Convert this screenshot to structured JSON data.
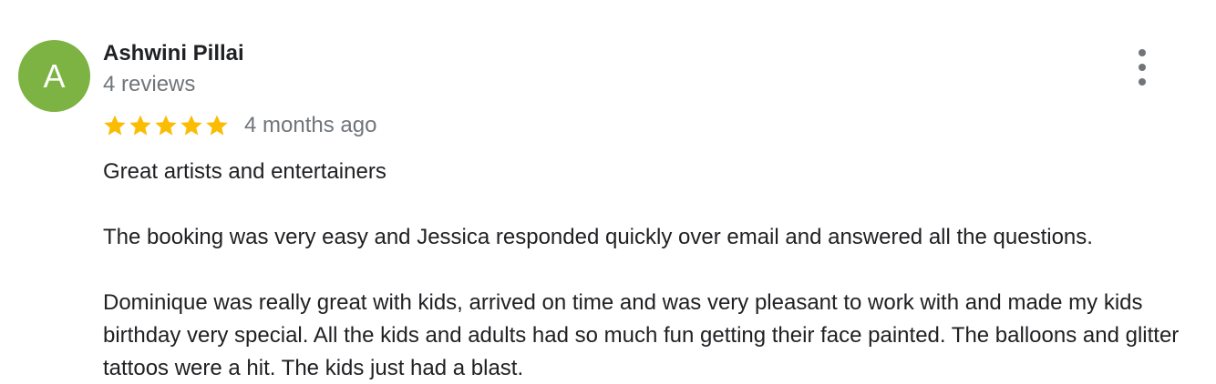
{
  "review": {
    "avatar_letter": "A",
    "avatar_color": "#7cb342",
    "author_name": "Ashwini Pillai",
    "review_count": "4 reviews",
    "rating": 5,
    "rating_max": 5,
    "star_color": "#fbbc04",
    "time_ago": "4 months ago",
    "more_icon": "more-vert-icon",
    "paragraphs": [
      "Great artists and entertainers",
      "The booking was very easy and Jessica responded quickly over email and answered all the questions.",
      "Dominique was really great with kids, arrived on time and was very pleasant to work with and made my kids birthday very special. All the kids and adults had so much fun getting their face painted. The balloons and glitter tattoos were a hit. The kids just had a blast."
    ]
  }
}
